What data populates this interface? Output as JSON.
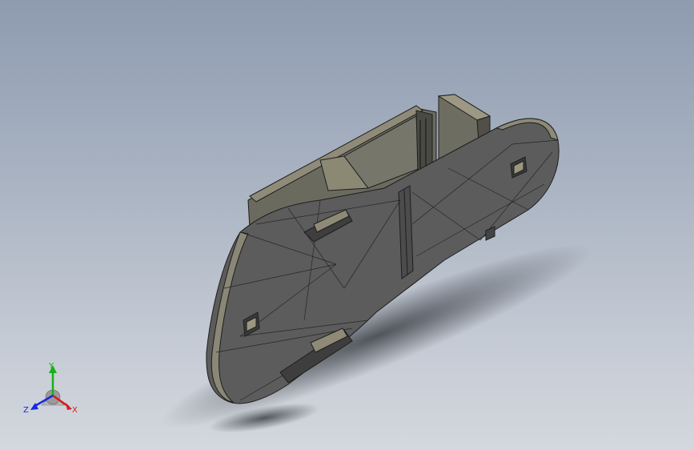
{
  "viewport": {
    "background_top": "#8e9bb0",
    "background_bottom": "#d3d8de"
  },
  "model": {
    "face_color": "#5a5a5a",
    "edge_color": "#1e1e1e",
    "highlight_color": "#8f8b78"
  },
  "triad": {
    "x_label": "X",
    "y_label": "Y",
    "z_label": "Z",
    "x_color": "#e01818",
    "y_color": "#18b018",
    "z_color": "#1828e0"
  }
}
